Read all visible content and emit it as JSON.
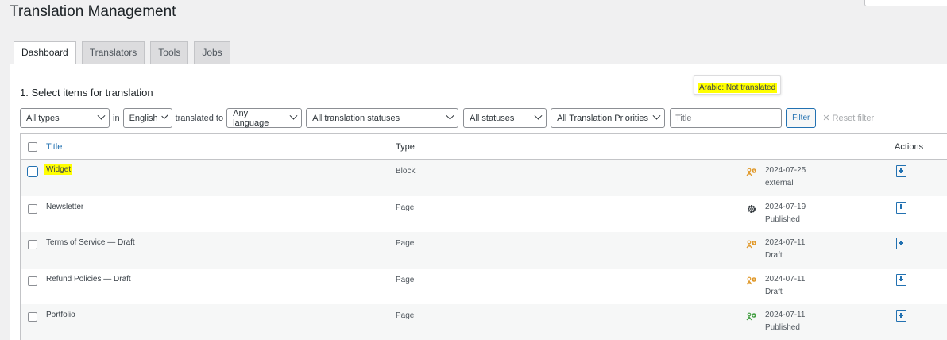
{
  "page": {
    "title": "Translation Management"
  },
  "tabs": [
    {
      "label": "Dashboard",
      "active": true
    },
    {
      "label": "Translators",
      "active": false
    },
    {
      "label": "Tools",
      "active": false
    },
    {
      "label": "Jobs",
      "active": false
    }
  ],
  "section": {
    "title": "1. Select items for translation"
  },
  "filters": {
    "type": "All types",
    "in_label": "in",
    "language_from": "English",
    "translated_to_label": "translated to",
    "language_to": "Any language",
    "translation_status": "All translation statuses",
    "status": "All statuses",
    "priority": "All Translation Priorities",
    "title_placeholder": "Title",
    "filter_button": "Filter",
    "reset_label": "Reset filter"
  },
  "table": {
    "headers": {
      "title": "Title",
      "type": "Type",
      "actions": "Actions"
    },
    "rows": [
      {
        "title": "Widget",
        "type": "Block",
        "status_icon": "translator-pending-icon",
        "date": "2024-07-25",
        "status": "external",
        "highlight": true
      },
      {
        "title": "Newsletter",
        "type": "Page",
        "status_icon": "gear-icon",
        "date": "2024-07-19",
        "status": "Published"
      },
      {
        "title": "Terms of Service — Draft",
        "type": "Page",
        "status_icon": "translator-pending-icon",
        "date": "2024-07-11",
        "status": "Draft"
      },
      {
        "title": "Refund Policies — Draft",
        "type": "Page",
        "status_icon": "translator-pending-icon",
        "date": "2024-07-11",
        "status": "Draft"
      },
      {
        "title": "Portfolio",
        "type": "Page",
        "status_icon": "translator-complete-icon",
        "date": "2024-07-11",
        "status": "Published"
      }
    ]
  },
  "tooltip": {
    "text": "Arabic: Not translated"
  },
  "colors": {
    "accent": "#2271b1",
    "pending": "#e0992b",
    "complete": "#46a046",
    "highlight": "#ffff00"
  }
}
